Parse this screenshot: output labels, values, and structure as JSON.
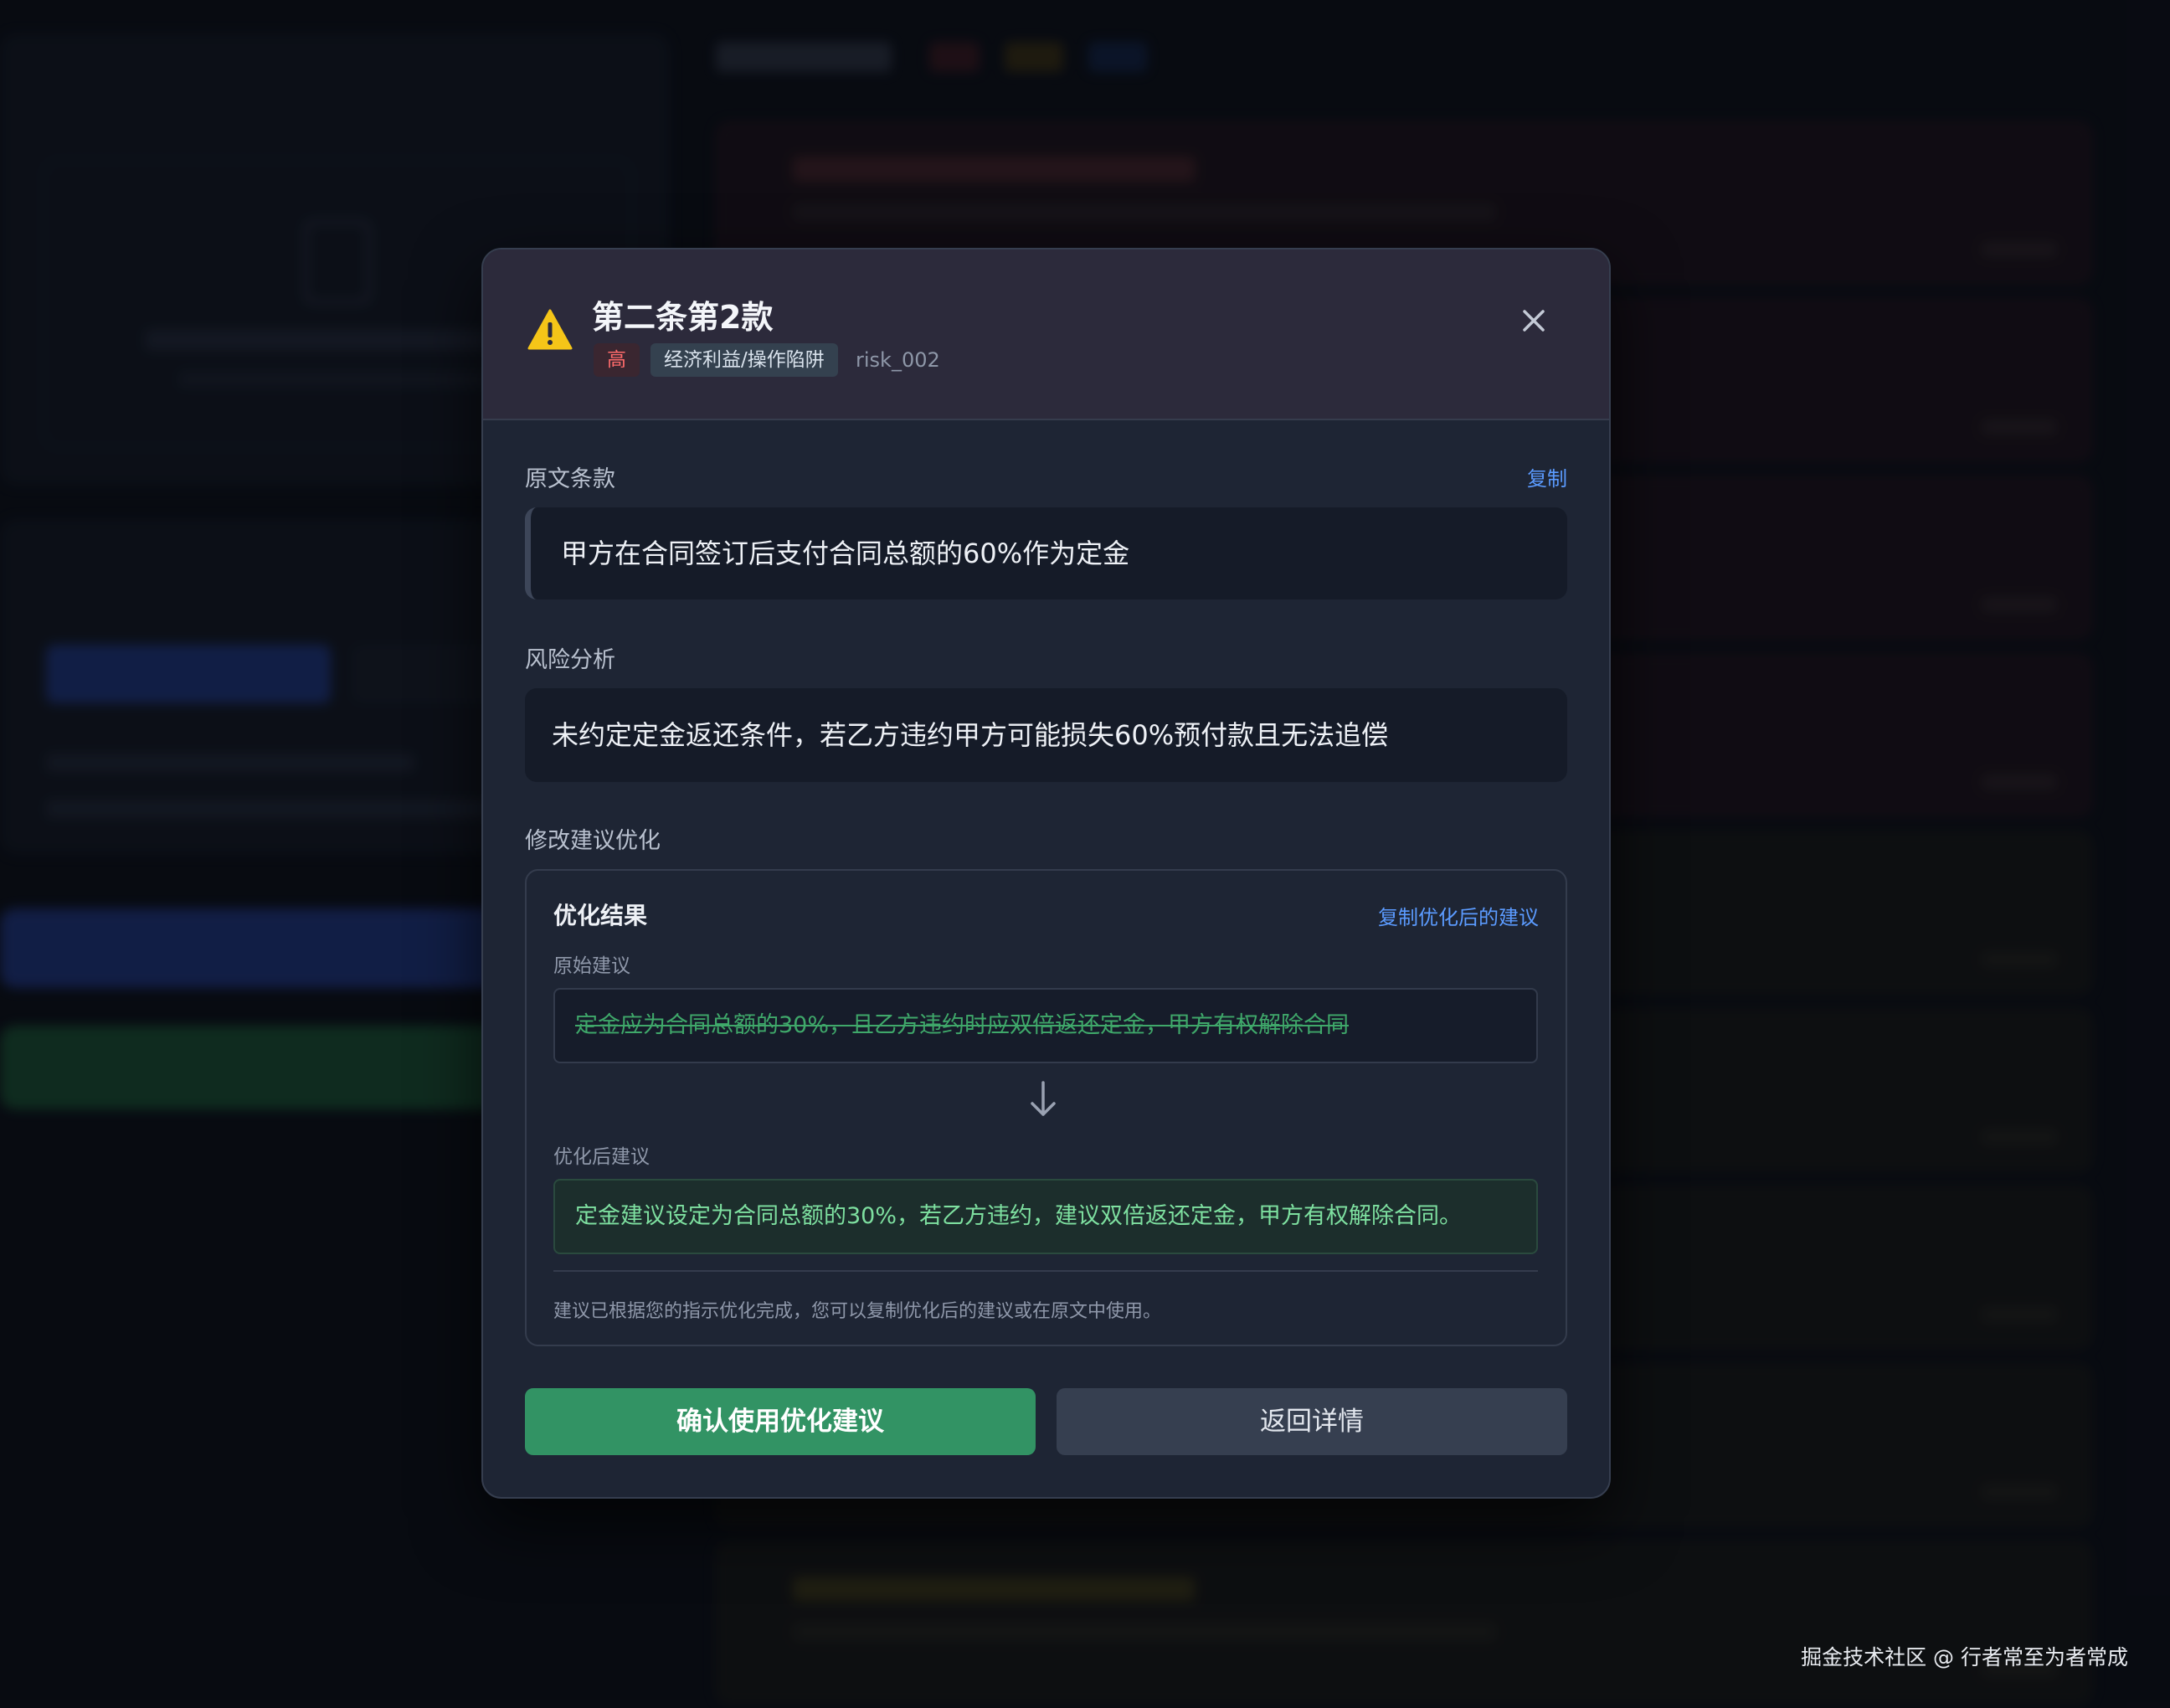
{
  "modal": {
    "title": "第二条第2款",
    "severity_badge": "高",
    "category_badge": "经济利益/操作陷阱",
    "risk_id": "risk_002",
    "original_clause": {
      "label": "原文条款",
      "copy_link": "复制",
      "text": "甲方在合同签订后支付合同总额的60%作为定金"
    },
    "risk_analysis": {
      "label": "风险分析",
      "text": "未约定定金返还条件，若乙方违约甲方可能损失60%预付款且无法追偿"
    },
    "optimize_section": {
      "label": "修改建议优化",
      "result_title": "优化结果",
      "copy_optimized_link": "复制优化后的建议",
      "original_suggestion_label": "原始建议",
      "original_suggestion": "定金应为合同总额的30%，且乙方违约时应双倍返还定金，甲方有权解除合同",
      "optimized_suggestion_label": "优化后建议",
      "optimized_suggestion": "定金建议设定为合同总额的30%，若乙方违约，建议双倍返还定金，甲方有权解除合同。",
      "note": "建议已根据您的指示优化完成，您可以复制优化后的建议或在原文中使用。"
    },
    "buttons": {
      "confirm": "确认使用优化建议",
      "back": "返回详情"
    }
  },
  "watermark": "掘金技术社区 @ 行者常至为者常成",
  "colors": {
    "severity_high": "#ff6b6b",
    "accent_link": "#5b9bff",
    "primary_button": "#329364",
    "optimized_text": "#7ee0a0",
    "warning_icon": "#f5c518"
  },
  "icons": {
    "header": "warning-triangle-icon",
    "close": "close-icon",
    "transform": "arrow-down-icon"
  }
}
